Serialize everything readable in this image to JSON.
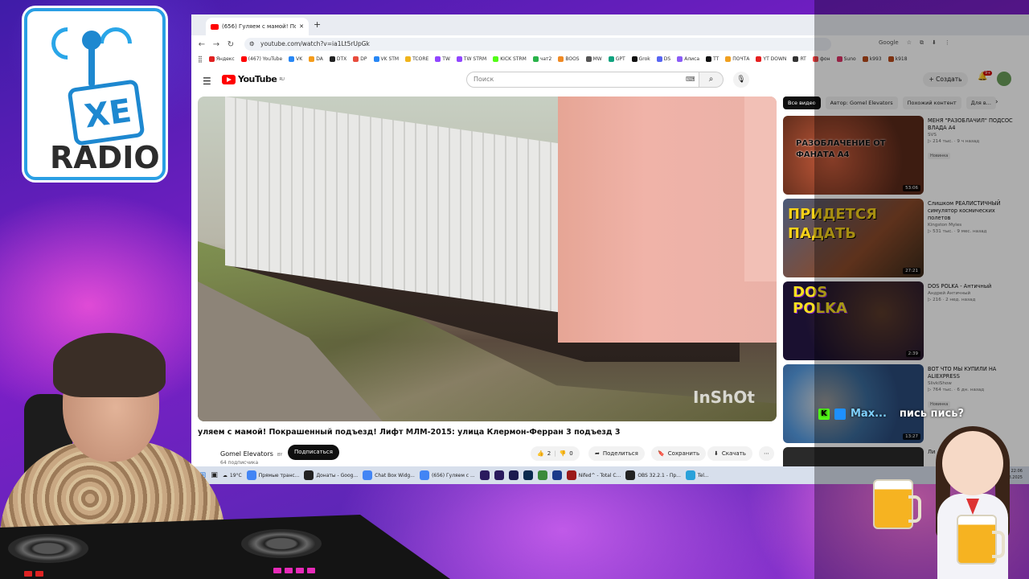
{
  "stream_overlay": {
    "logo_text": "XE",
    "logo_subtext": "RADIO",
    "chat": {
      "user": "Max...",
      "message": "пись пись?",
      "platform_icon": "kick-icon"
    }
  },
  "browser": {
    "tab_title": "(656) Гуляем с мамой! Покраш...",
    "new_tab_label": "+",
    "url": "youtube.com/watch?v=ia1Lt5rUpGk",
    "right_items": [
      "Google",
      "☆",
      "⧉",
      "⬇",
      "⋮"
    ],
    "bookmarks": [
      {
        "label": "Яндекс",
        "color": "#e02020"
      },
      {
        "label": "(467) YouTube",
        "color": "#ff0000"
      },
      {
        "label": "VK",
        "color": "#2787f5"
      },
      {
        "label": "DA",
        "color": "#f59c1a"
      },
      {
        "label": "DTX",
        "color": "#222222"
      },
      {
        "label": "DP",
        "color": "#e84c3d"
      },
      {
        "label": "VK STM",
        "color": "#2787f5"
      },
      {
        "label": "TCORE",
        "color": "#f0b41c"
      },
      {
        "label": "TW",
        "color": "#9146ff"
      },
      {
        "label": "TW STRM",
        "color": "#9146ff"
      },
      {
        "label": "KICK STRM",
        "color": "#53fc18"
      },
      {
        "label": "чат2",
        "color": "#2ab34a"
      },
      {
        "label": "BOOS",
        "color": "#f08a24"
      },
      {
        "label": "MW",
        "color": "#555555"
      },
      {
        "label": "GPT",
        "color": "#10a37f"
      },
      {
        "label": "Grok",
        "color": "#111111"
      },
      {
        "label": "DS",
        "color": "#5865f2"
      },
      {
        "label": "Алиса",
        "color": "#8a5cf6"
      },
      {
        "label": "TT",
        "color": "#111111"
      },
      {
        "label": "ПОЧТА",
        "color": "#f0a020"
      },
      {
        "label": "YT DOWN",
        "color": "#e52020"
      },
      {
        "label": "RT",
        "color": "#333333"
      },
      {
        "label": "фон",
        "color": "#ef4444"
      },
      {
        "label": "Suno",
        "color": "#dd3366"
      },
      {
        "label": "k993",
        "color": "#b84a1a"
      },
      {
        "label": "k918",
        "color": "#b84a1a"
      }
    ]
  },
  "youtube": {
    "logo": "YouTube",
    "logo_region": "RU",
    "search_placeholder": "Поиск",
    "create_label": "+ Создать",
    "notifications_badge": "9+",
    "video": {
      "watermark": "InShOt",
      "title": "уляем с мамой! Покрашенный подъезд! Лифт МЛМ-2015: улица Клермон-Ферран 3 подъезд 3",
      "channel": "Gomel Elevators",
      "channel_badge": "BY",
      "subscribers": "64 подписчика",
      "subscribe_label": "Подписаться",
      "likes": "2",
      "dislikes": "0",
      "share_label": "Поделиться",
      "save_label": "Сохранить",
      "download_label": "Скачать",
      "more_label": "⋯"
    },
    "chips": [
      "Все видео",
      "Автор: Gomel Elevators",
      "Похожий контент",
      "Для в..."
    ],
    "recommendations": [
      {
        "title": "МЕНЯ \"РАЗОБЛАЧИЛ\" ПОДСОС ВЛАДА А4",
        "channel": "SVS",
        "meta": "▷ 214 тыс. · 9 ч назад",
        "badge": "Новинка",
        "duration": "53:06",
        "thumb_text": "РАЗОБЛАЧЕНИЕ ОТ ФАНАТА А4"
      },
      {
        "title": "Слишком РЕАЛИСТИЧНЫЙ симулятор космических полетов",
        "channel": "Kingston Myles",
        "meta": "▷ 531 тыс. · 9 мес. назад",
        "badge": "",
        "duration": "27:21",
        "thumb_text": "ПРИДЕТСЯ ПАДАТЬ"
      },
      {
        "title": "DOS POLKA - Античный",
        "channel": "Андрей Античный",
        "meta": "▷ 216 · 2 нед. назад",
        "badge": "",
        "duration": "2:39",
        "thumb_text": "DOS POLKA"
      },
      {
        "title": "ВОТ ЧТО МЫ КУПИЛИ НА ALIEXPRESS",
        "channel": "SlivkiShow",
        "meta": "▷ 764 тыс. · 6 дн. назад",
        "badge": "Новинка",
        "duration": "13:27",
        "thumb_text": ""
      }
    ],
    "partial_next_title": "Ли"
  },
  "taskbar": {
    "weather": "19°C",
    "items": [
      {
        "label": "Прямые транс...",
        "color": "#4285f4"
      },
      {
        "label": "Донаты - Goog...",
        "color": "#222222"
      },
      {
        "label": "Chat Box Widg...",
        "color": "#4285f4"
      },
      {
        "label": "(656) Гуляем с ...",
        "color": "#4285f4"
      },
      {
        "label": "",
        "color": "#2a1a5e"
      },
      {
        "label": "",
        "color": "#2a1a5e"
      },
      {
        "label": "",
        "color": "#1a1a4e"
      },
      {
        "label": "",
        "color": "#0a2a4e"
      },
      {
        "label": "",
        "color": "#3a8a3a"
      },
      {
        "label": "",
        "color": "#1a3a8a"
      },
      {
        "label": "Nifed^ - Total C...",
        "color": "#9a1a1a"
      },
      {
        "label": "OBS 32.2.1 - Пр...",
        "color": "#222222"
      },
      {
        "label": "Tel...",
        "color": "#2aa1da"
      }
    ],
    "time": "22:06",
    "date": "16.08.2025"
  },
  "colors": {
    "youtube_red": "#ff0000",
    "logo_blue": "#1e88d0",
    "kick_green": "#53fc18"
  }
}
